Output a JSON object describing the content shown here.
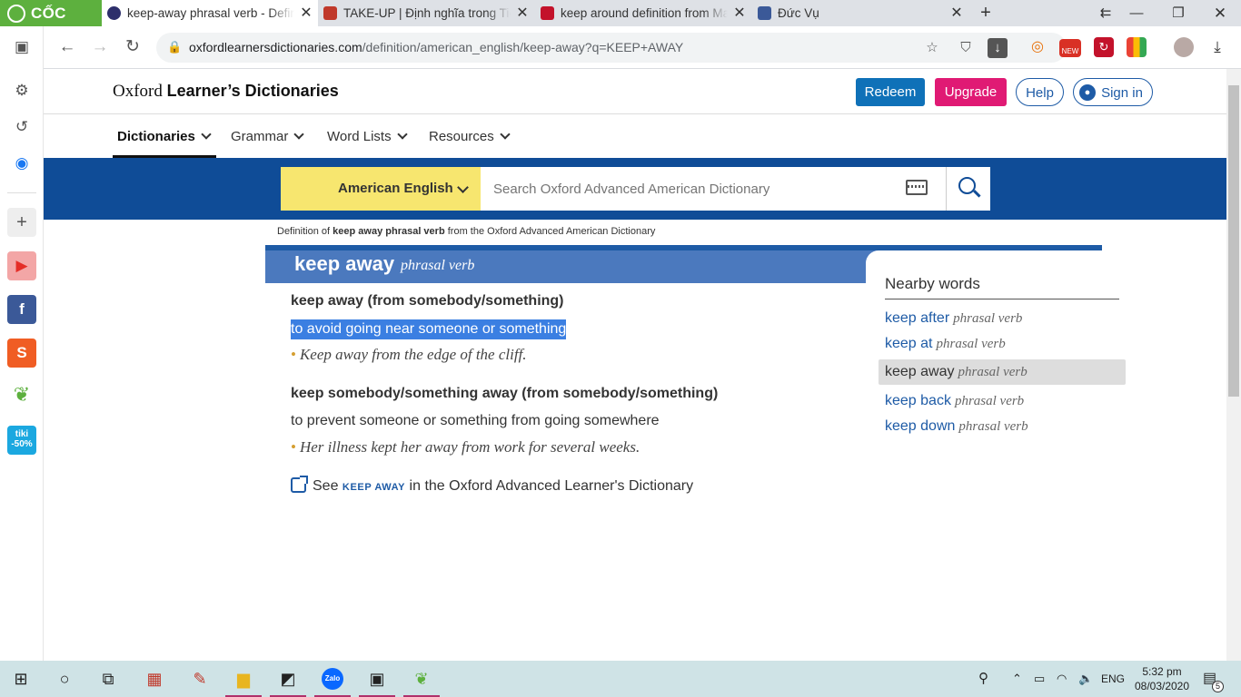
{
  "browser": {
    "brand": "CỐC CỐC",
    "tabs": [
      {
        "title": "keep-away phrasal verb - Definition",
        "favicon_color": "#2d2f6b"
      },
      {
        "title": "TAKE-UP | Định nghĩa trong Tiếng",
        "favicon_color": "#c0392b"
      },
      {
        "title": "keep around definition from Mac",
        "favicon_color": "#c3122b"
      },
      {
        "title": "Đức Vụ",
        "favicon_color": "#3b5998"
      }
    ],
    "new_tab": "+",
    "url_host": "oxfordlearnersdictionaries.com",
    "url_path": "/definition/american_english/keep-away?q=KEEP+AWAY",
    "ext_new_badge": "NEW"
  },
  "site": {
    "logo_light": "Oxford",
    "logo_bold": "Learner’s Dictionaries",
    "redeem": "Redeem",
    "upgrade": "Upgrade",
    "help": "Help",
    "sign_in": "Sign in",
    "nav": [
      "Dictionaries",
      "Grammar",
      "Word Lists",
      "Resources"
    ],
    "dictionary_select": "American English",
    "search_placeholder": "Search Oxford Advanced American Dictionary",
    "colors": {
      "band": "#0f4c97",
      "select": "#f7e66f",
      "redeem": "#0f71b8",
      "upgrade": "#e01a74",
      "link": "#1e5ba6"
    }
  },
  "entry": {
    "breadcrumb_pre": "Definition of ",
    "breadcrumb_bold": "keep away phrasal verb",
    "breadcrumb_post": " from the Oxford Advanced American Dictionary",
    "headword": "keep away",
    "pos": "phrasal verb",
    "senses": [
      {
        "head": "keep away (from somebody/something)",
        "def": "to avoid going near someone or something",
        "example": "Keep away from the edge of the cliff."
      },
      {
        "head": "keep somebody/something away (from somebody/something)",
        "def": "to prevent someone or something from going somewhere",
        "example": "Her illness kept her away from work for several weeks."
      }
    ],
    "see_pre": "See ",
    "see_link": "KEEP AWAY",
    "see_post": " in the Oxford Advanced Learner's Dictionary"
  },
  "nearby": {
    "title": "Nearby words",
    "items": [
      {
        "word": "keep after",
        "pos": "phrasal verb"
      },
      {
        "word": "keep at",
        "pos": "phrasal verb"
      },
      {
        "word": "keep away",
        "pos": "phrasal verb"
      },
      {
        "word": "keep back",
        "pos": "phrasal verb"
      },
      {
        "word": "keep down",
        "pos": "phrasal verb"
      }
    ]
  },
  "taskbar": {
    "lang": "ENG",
    "time": "5:32 pm",
    "date": "08/03/2020",
    "zalo": "Zalo",
    "notif_count": "5"
  },
  "sidebar": {
    "tiki": "tiki",
    "tiki_sale": "-50%"
  }
}
